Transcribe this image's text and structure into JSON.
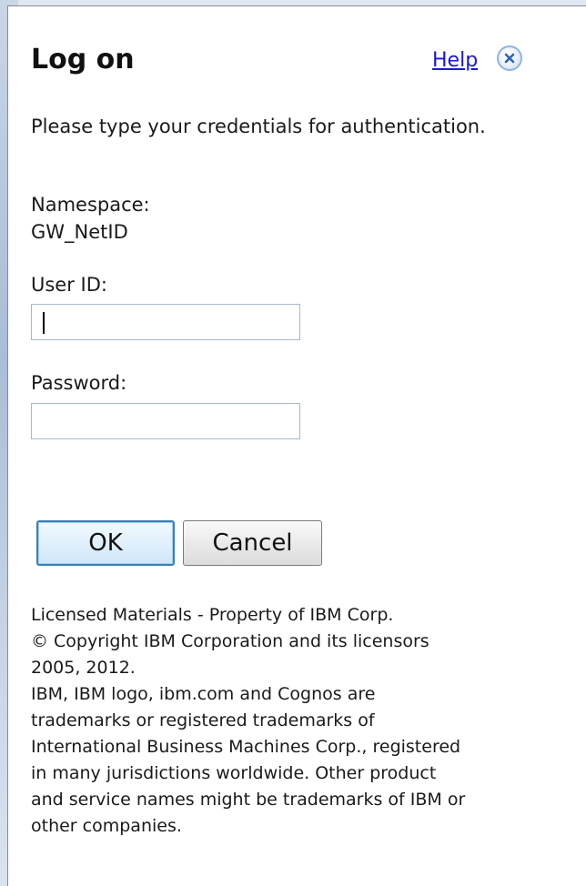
{
  "dialog": {
    "title": "Log on",
    "help_label": "Help",
    "close_icon": "close-icon",
    "instructions": "Please type your credentials for authentication."
  },
  "namespace": {
    "label": "Namespace:",
    "value": "GW_NetID"
  },
  "user_id": {
    "label": "User ID:",
    "value": "",
    "placeholder": ""
  },
  "password": {
    "label": "Password:",
    "value": "",
    "placeholder": ""
  },
  "buttons": {
    "ok_label": "OK",
    "cancel_label": "Cancel"
  },
  "legal": {
    "lines": [
      "Licensed Materials - Property of IBM Corp.",
      "© Copyright IBM Corporation and its licensors",
      "2005, 2012.",
      "IBM, IBM logo, ibm.com and Cognos are",
      "trademarks or registered trademarks of",
      "International Business Machines Corp., registered",
      "in many jurisdictions worldwide. Other product",
      "and service names might be trademarks of IBM or",
      "other companies."
    ]
  },
  "colors": {
    "link": "#1a1acc",
    "ok_border": "#3c7fb1",
    "close_ring": "#8fb4e0"
  }
}
